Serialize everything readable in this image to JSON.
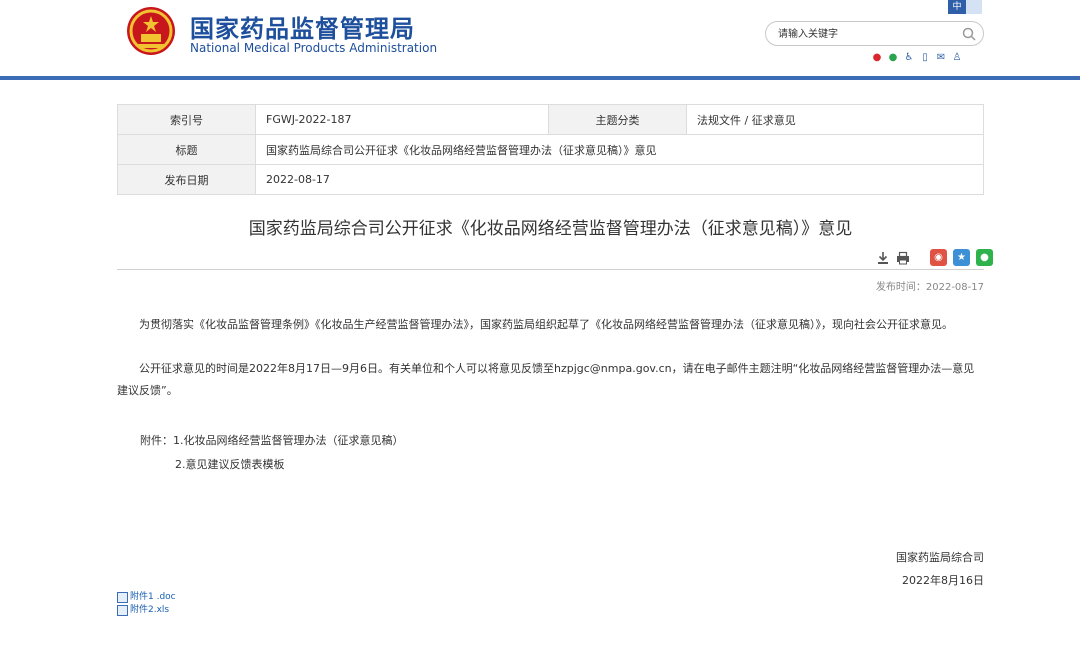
{
  "header": {
    "site_name_cn": "国家药品监督管理局",
    "site_name_en": "National Medical Products Administration",
    "lang_cn": "中",
    "search_placeholder": "请输入关键字"
  },
  "meta": {
    "rows": [
      {
        "k1": "索引号",
        "v1": "FGWJ-2022-187",
        "k2": "主题分类",
        "v2": "法规文件 / 征求意见"
      },
      {
        "k1": "标题",
        "v1": "国家药监局综合司公开征求《化妆品网络经营监督管理办法（征求意见稿）》意见"
      },
      {
        "k1": "发布日期",
        "v1": "2022-08-17"
      }
    ]
  },
  "article": {
    "title": "国家药监局综合司公开征求《化妆品网络经营监督管理办法（征求意见稿）》意见",
    "pubtime": "发布时间：2022-08-17",
    "p1": "为贯彻落实《化妆品监督管理条例》《化妆品生产经营监督管理办法》，国家药监局组织起草了《化妆品网络经营监督管理办法（征求意见稿）》，现向社会公开征求意见。",
    "p2": "公开征求意见的时间是2022年8月17日—9月6日。有关单位和个人可以将意见反馈至hzpjgc@nmpa.gov.cn，请在电子邮件主题注明“化妆品网络经营监督管理办法—意见建议反馈”。",
    "attachment_1": "附件：1.化妆品网络经营监督管理办法（征求意见稿）",
    "attachment_2": "2.意见建议反馈表模板",
    "signer": "国家药监局综合司",
    "sign_date": "2022年8月16日"
  },
  "files": [
    {
      "label": "附件1 .doc"
    },
    {
      "label": "附件2.xls"
    }
  ],
  "colors": {
    "brand_blue": "#1d4f9c",
    "header_bar": "#3a6db5"
  }
}
